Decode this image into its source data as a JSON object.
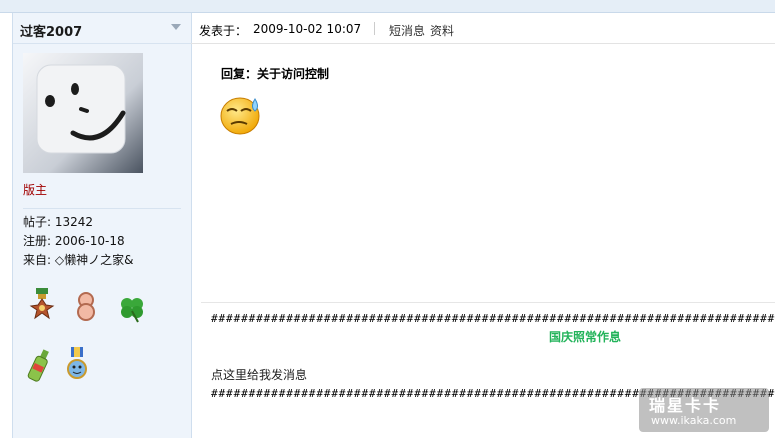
{
  "sidebar": {
    "username": "过客2007",
    "role": "版主",
    "stats": [
      {
        "label": "帖子:",
        "value": "13242"
      },
      {
        "label": "注册:",
        "value": "2006-10-18"
      },
      {
        "label": "来自:",
        "value": "◇懒神ノ之家&"
      }
    ]
  },
  "post": {
    "label": "发表于：",
    "timestamp": "2009-10-02 10:07",
    "actions": {
      "pm": "短消息",
      "profile": "资料"
    },
    "reply_title": "回复：关于访问控制"
  },
  "signature": {
    "hash_line": "###########################################################################",
    "holiday_text": "国庆照常作息",
    "message_link": "点这里给我发消息"
  },
  "watermark": {
    "title": "瑞星卡卡",
    "url": "www.ikaka.com"
  },
  "colors": {
    "role": "#a10000",
    "holiday": "#22b35a",
    "sidebar_bg": "#eef4fb"
  }
}
